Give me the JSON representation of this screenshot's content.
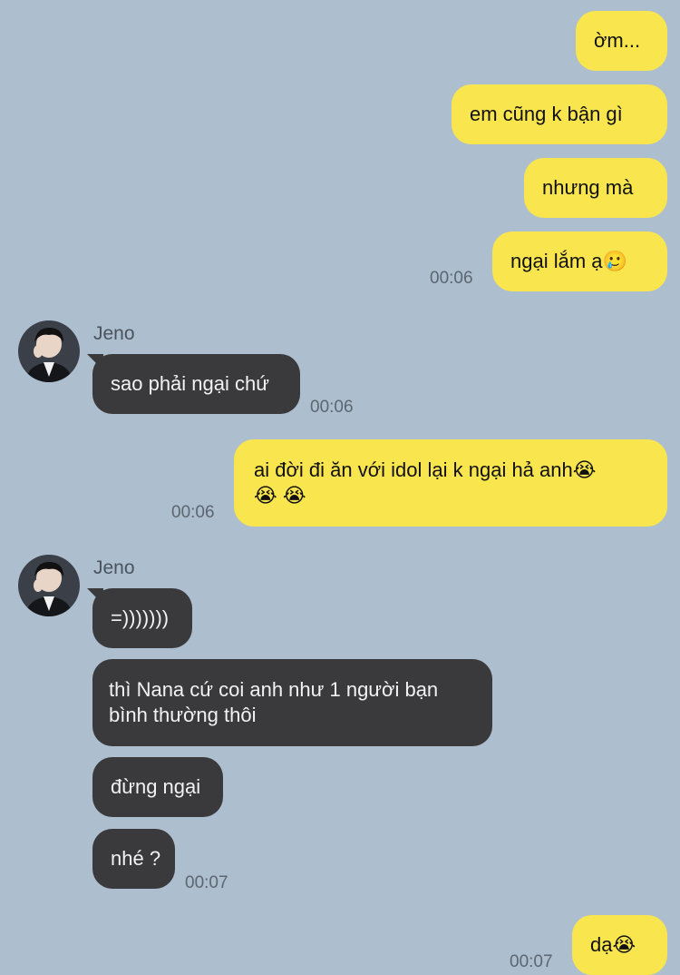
{
  "chat": {
    "messages": [
      {
        "id": "m1",
        "text": "ờm...",
        "side": "out"
      },
      {
        "id": "m2",
        "text": "em cũng k bận gì",
        "side": "out"
      },
      {
        "id": "m3",
        "text": "nhưng mà",
        "side": "out"
      },
      {
        "id": "m4",
        "text": "ngại lắm ạ🥲",
        "side": "out",
        "time": "00:06"
      },
      {
        "id": "m5",
        "text": "sao phải ngại chứ",
        "side": "in",
        "sender": "Jeno",
        "time": "00:06"
      },
      {
        "id": "m6",
        "line1": "ai đời đi ăn với idol lại k ngại hả anh😭",
        "line2": "😭 😭",
        "side": "out",
        "time": "00:06"
      },
      {
        "id": "m7",
        "text": "=)))))))",
        "side": "in",
        "sender": "Jeno"
      },
      {
        "id": "m8",
        "line1": "thì Nana cứ coi anh như 1 người bạn",
        "line2": "bình thường thôi",
        "side": "in"
      },
      {
        "id": "m9",
        "text": "đừng ngại",
        "side": "in"
      },
      {
        "id": "m10",
        "text": "nhé ?",
        "side": "in",
        "time": "00:07"
      },
      {
        "id": "m11",
        "text": "dạ😭",
        "side": "out",
        "time": "00:07"
      }
    ],
    "colors": {
      "background": "#adbecf",
      "outgoing_bubble": "#f9e54e",
      "incoming_bubble": "#3a3a3c"
    },
    "avatar_icon": "contact-photo"
  }
}
